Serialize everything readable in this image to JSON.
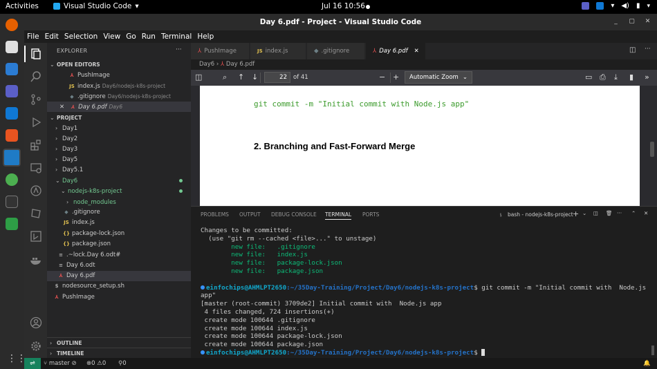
{
  "topbar": {
    "activities": "Activities",
    "app_name": "Visual Studio Code",
    "datetime": "Jul 16  10:56"
  },
  "window": {
    "title": "Day 6.pdf - Project - Visual Studio Code"
  },
  "menu": [
    "File",
    "Edit",
    "Selection",
    "View",
    "Go",
    "Run",
    "Terminal",
    "Help"
  ],
  "explorer": {
    "header": "EXPLORER",
    "more": "···",
    "open_editors_label": "OPEN EDITORS",
    "open_editors": [
      {
        "icon": "pdf-icon",
        "name": "PushImage",
        "desc": ""
      },
      {
        "icon": "JS",
        "name": "index.js",
        "desc": "Day6/nodejs-k8s-project"
      },
      {
        "icon": "◆",
        "name": ".gitignore",
        "desc": "Day6/nodejs-k8s-project"
      },
      {
        "icon": "pdf-icon",
        "name": "Day 6.pdf",
        "desc": "Day6"
      }
    ],
    "project_label": "PROJECT",
    "tree": [
      {
        "name": "Day1"
      },
      {
        "name": "Day2"
      },
      {
        "name": "Day3"
      },
      {
        "name": "Day5"
      },
      {
        "name": "Day5.1"
      },
      {
        "name": "Day6"
      },
      {
        "name": "nodejs-k8s-project"
      },
      {
        "name": "node_modules"
      },
      {
        "name": ".gitignore",
        "icon": "◆"
      },
      {
        "name": "index.js",
        "icon": "JS"
      },
      {
        "name": "package-lock.json",
        "icon": "{}"
      },
      {
        "name": "package.json",
        "icon": "{}"
      },
      {
        "name": ".~lock.Day 6.odt#",
        "icon": "≡"
      },
      {
        "name": "Day 6.odt",
        "icon": "≡"
      },
      {
        "name": "Day 6.pdf",
        "icon": "pdf"
      },
      {
        "name": "nodesource_setup.sh",
        "icon": "$"
      },
      {
        "name": "PushImage",
        "icon": "pdf"
      }
    ],
    "outline_label": "OUTLINE",
    "timeline_label": "TIMELINE"
  },
  "tabs": [
    {
      "label": "PushImage",
      "icon": "pdf"
    },
    {
      "label": "index.js",
      "icon": "JS"
    },
    {
      "label": ".gitignore",
      "icon": "◆"
    },
    {
      "label": "Day 6.pdf",
      "icon": "pdf"
    }
  ],
  "breadcrumb": {
    "folder": "Day6",
    "file": "Day 6.pdf"
  },
  "pdf": {
    "page": "22",
    "of_pages": "of 41",
    "zoom": "Automatic Zoom",
    "code_line": "git commit -m \"Initial commit with Node.js app\"",
    "heading": "2. Branching and Fast-Forward Merge"
  },
  "panel": {
    "tabs": [
      "PROBLEMS",
      "OUTPUT",
      "DEBUG CONSOLE",
      "TERMINAL",
      "PORTS"
    ],
    "terminal_name": "bash - nodejs-k8s-project",
    "terminal": {
      "l1": "Changes to be committed:",
      "l2": "  (use \"git rm --cached <file>...\" to unstage)",
      "new_files": [
        "        new file:   .gitignore",
        "        new file:   index.js",
        "        new file:   package-lock.json",
        "        new file:   package.json"
      ],
      "prompt_user": "einfochips@AHMLPT2650",
      "prompt_path": ":~/35Day-Training/Project/Day6/nodejs-k8s-project",
      "command": "$ git commit -m \"Initial commit with  Node.js",
      "command_wrap": "app\"",
      "output": [
        "[master (root-commit) 3709de2] Initial commit with  Node.js app",
        " 4 files changed, 724 insertions(+)",
        " create mode 100644 .gitignore",
        " create mode 100644 index.js",
        " create mode 100644 package-lock.json",
        " create mode 100644 package.json"
      ],
      "prompt_end": "$ "
    }
  },
  "status": {
    "branch": "master",
    "sync": "",
    "problems": "⊗0 ⚠0",
    "ports": "0"
  }
}
